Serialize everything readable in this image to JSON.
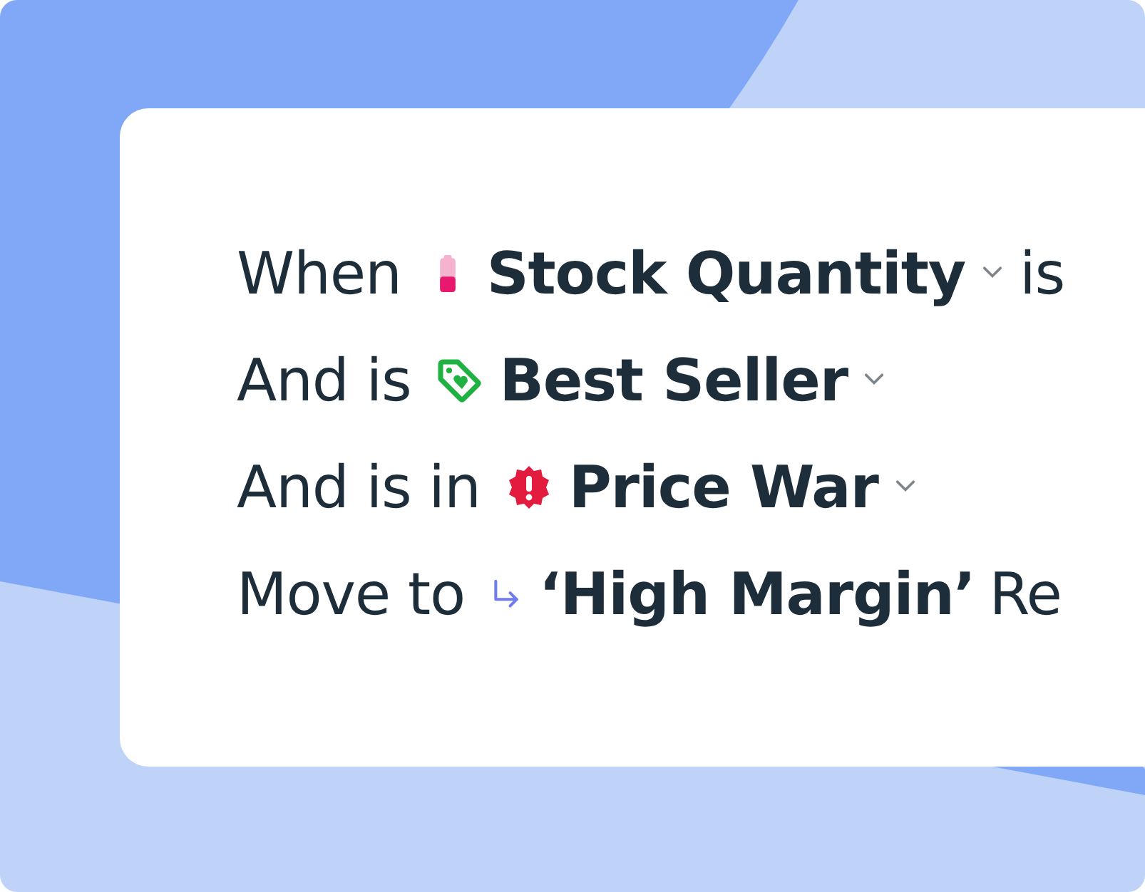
{
  "rules": [
    {
      "prefix": "When",
      "kind": "battery",
      "field": "Stock Quantity",
      "has_dropdown": true,
      "suffix": "is"
    },
    {
      "prefix": "And is",
      "kind": "tag",
      "field": "Best Seller",
      "has_dropdown": true
    },
    {
      "prefix": "And is in",
      "kind": "alert",
      "field": "Price War",
      "has_dropdown": true
    },
    {
      "prefix": "Move to",
      "kind": "arrow",
      "field": "‘High Margin’",
      "has_dropdown": false,
      "suffix": "Re"
    }
  ]
}
